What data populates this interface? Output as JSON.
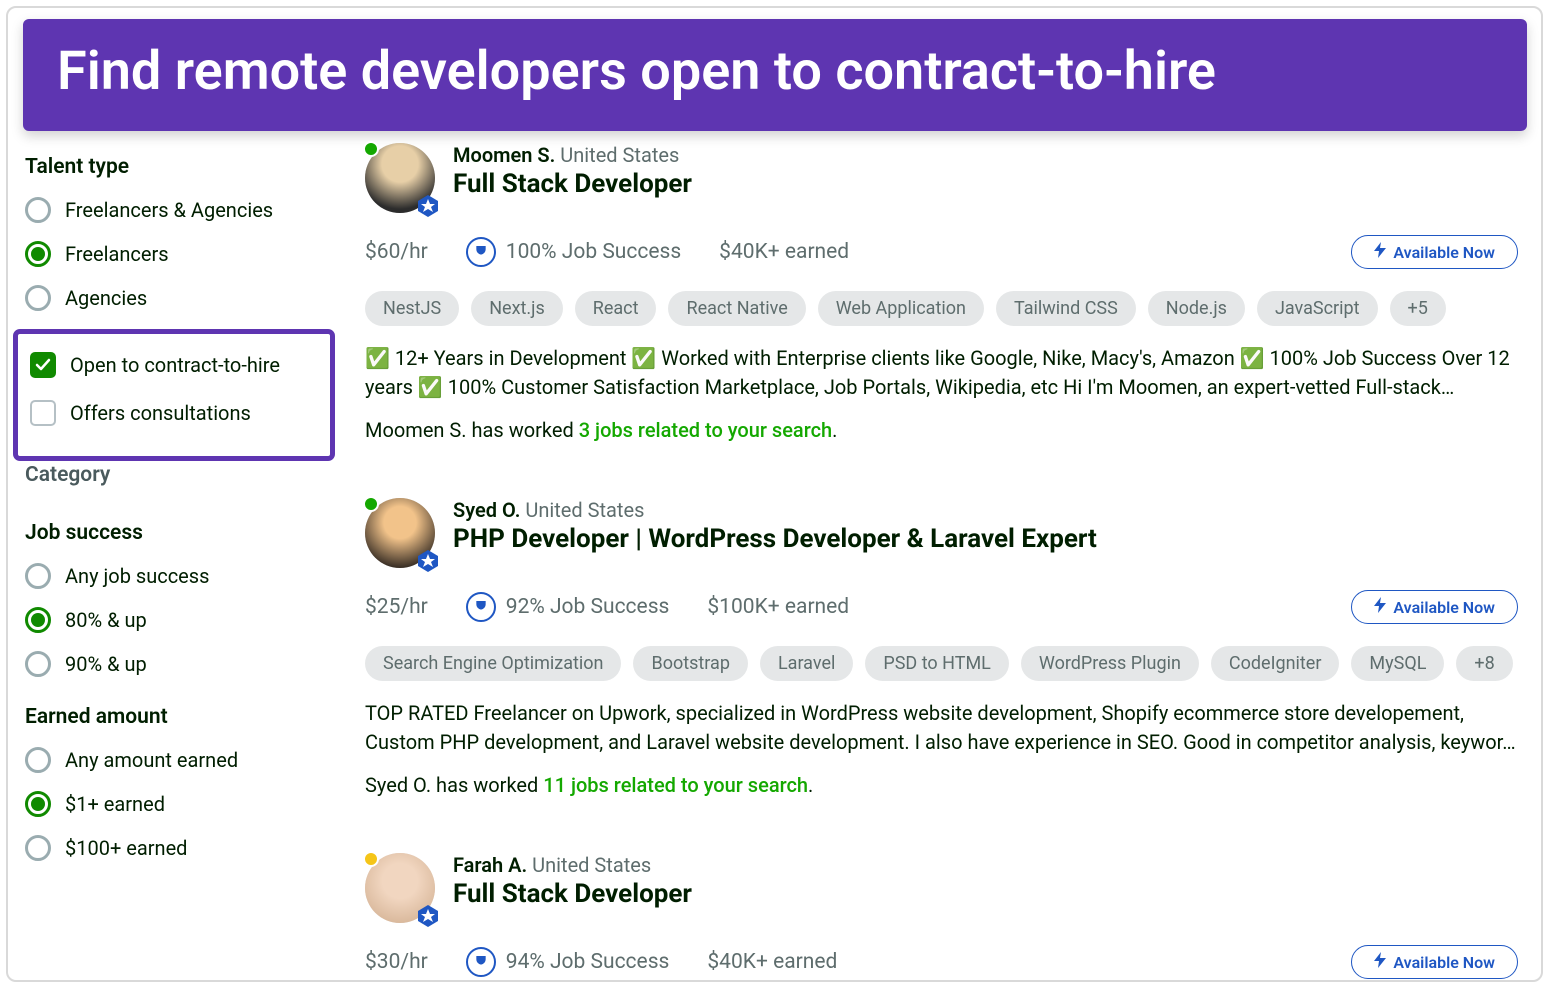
{
  "banner": {
    "text": "Find remote developers open to contract-to-hire"
  },
  "sidebar": {
    "talent_type": {
      "heading": "Talent type",
      "options": [
        {
          "label": "Freelancers & Agencies",
          "selected": false
        },
        {
          "label": "Freelancers",
          "selected": true
        },
        {
          "label": "Agencies",
          "selected": false
        }
      ]
    },
    "contract_filters": [
      {
        "label": "Open to contract-to-hire",
        "checked": true
      },
      {
        "label": "Offers consultations",
        "checked": false
      }
    ],
    "category_heading": "Category",
    "job_success": {
      "heading": "Job success",
      "options": [
        {
          "label": "Any job success",
          "selected": false
        },
        {
          "label": "80% & up",
          "selected": true
        },
        {
          "label": "90% & up",
          "selected": false
        }
      ]
    },
    "earned_amount": {
      "heading": "Earned amount",
      "options": [
        {
          "label": "Any amount earned",
          "selected": false
        },
        {
          "label": "$1+ earned",
          "selected": true
        },
        {
          "label": "$100+ earned",
          "selected": false
        }
      ]
    }
  },
  "cards": [
    {
      "name": "Moomen S.",
      "location": "United States",
      "title": "Full Stack Developer",
      "status": "green",
      "rate": "$60/hr",
      "job_success": "100% Job Success",
      "earned": "$40K+ earned",
      "available_label": "Available Now",
      "skills": [
        "NestJS",
        "Next.js",
        "React",
        "React Native",
        "Web Application",
        "Tailwind CSS",
        "Node.js",
        "JavaScript",
        "+5"
      ],
      "bio": "✅ 12+ Years in Development ✅ Worked with Enterprise clients like Google, Nike, Macy's, Amazon ✅ 100% Job Success Over 12 years ✅ 100% Customer Satisfaction Marketplace, Job Portals, Wikipedia, etc Hi I'm Moomen, an expert-vetted Full-stack…",
      "worked_prefix": "Moomen S. has worked ",
      "worked_link": "3 jobs related to your search",
      "worked_suffix": "."
    },
    {
      "name": "Syed O.",
      "location": "United States",
      "title": "PHP Developer | WordPress Developer & Laravel Expert",
      "status": "green",
      "rate": "$25/hr",
      "job_success": "92% Job Success",
      "earned": "$100K+ earned",
      "available_label": "Available Now",
      "skills": [
        "Search Engine Optimization",
        "Bootstrap",
        "Laravel",
        "PSD to HTML",
        "WordPress Plugin",
        "CodeIgniter",
        "MySQL",
        "+8"
      ],
      "bio": "TOP RATED Freelancer on Upwork, specialized in WordPress website development, Shopify ecommerce store developement, Custom PHP development, and Laravel website development. I also have experience in SEO. Good in competitor analysis, keywor…",
      "worked_prefix": "Syed O. has worked ",
      "worked_link": "11 jobs related to your search",
      "worked_suffix": "."
    },
    {
      "name": "Farah A.",
      "location": "United States",
      "title": "Full Stack Developer",
      "status": "yellow",
      "rate": "$30/hr",
      "job_success": "94% Job Success",
      "earned": "$40K+ earned",
      "available_label": "Available Now",
      "skills": [],
      "bio": "",
      "worked_prefix": "",
      "worked_link": "",
      "worked_suffix": ""
    }
  ]
}
